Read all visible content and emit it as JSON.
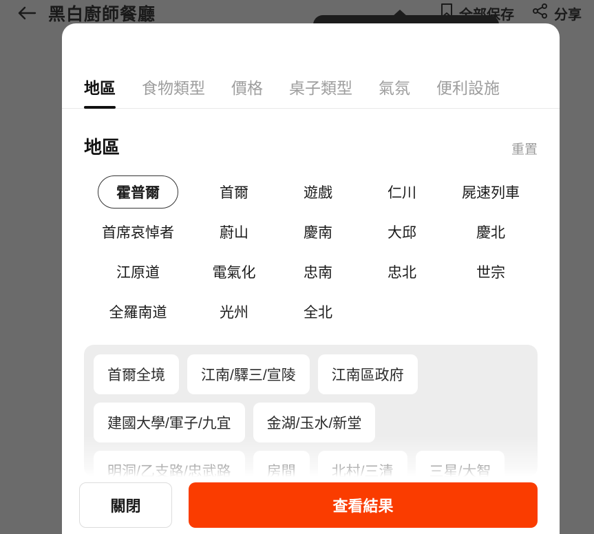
{
  "background_app": {
    "back_icon": "arrow-left-icon",
    "title": "黑白廚師餐廳",
    "actions": [
      {
        "icon": "bookmark-icon",
        "label": "全部保存"
      },
      {
        "icon": "share-icon",
        "label": "分享"
      }
    ]
  },
  "modal": {
    "tabs": [
      {
        "label": "地區",
        "active": true
      },
      {
        "label": "食物類型",
        "active": false
      },
      {
        "label": "價格",
        "active": false
      },
      {
        "label": "桌子類型",
        "active": false
      },
      {
        "label": "氣氛",
        "active": false
      },
      {
        "label": "便利設施",
        "active": false
      }
    ],
    "section": {
      "title": "地區",
      "reset_label": "重置"
    },
    "regions": [
      {
        "label": "霍普爾",
        "selected": true
      },
      {
        "label": "首爾",
        "selected": false
      },
      {
        "label": "遊戲",
        "selected": false
      },
      {
        "label": "仁川",
        "selected": false
      },
      {
        "label": "屍速列車",
        "selected": false
      },
      {
        "label": "首席哀悼者",
        "selected": false
      },
      {
        "label": "蔚山",
        "selected": false
      },
      {
        "label": "慶南",
        "selected": false
      },
      {
        "label": "大邱",
        "selected": false
      },
      {
        "label": "慶北",
        "selected": false
      },
      {
        "label": "江原道",
        "selected": false
      },
      {
        "label": "電氣化",
        "selected": false
      },
      {
        "label": "忠南",
        "selected": false
      },
      {
        "label": "忠北",
        "selected": false
      },
      {
        "label": "世宗",
        "selected": false
      },
      {
        "label": "全羅南道",
        "selected": false
      },
      {
        "label": "光州",
        "selected": false
      },
      {
        "label": "全北",
        "selected": false
      }
    ],
    "sub_regions": [
      "首爾全境",
      "江南/驛三/宣陵",
      "江南區政府",
      "建國大學/軍子/九宜",
      "金湖/玉水/新堂",
      "明洞/乙支路/忠武路",
      "房間",
      "北村/三清",
      "三星/大智"
    ],
    "footer": {
      "close_label": "關閉",
      "submit_label": "查看結果",
      "submit_color": "#fa3c00"
    }
  }
}
